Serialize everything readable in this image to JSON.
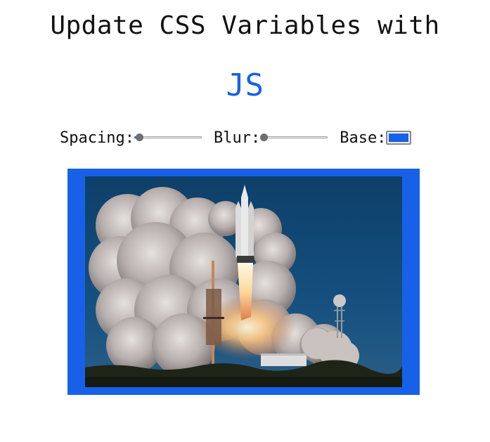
{
  "page": {
    "title_main": "Update CSS Variables with",
    "title_highlight": "JS"
  },
  "controls": {
    "spacing": {
      "label": "Spacing:",
      "value_fraction": 0.02
    },
    "blur": {
      "label": "Blur:",
      "value_fraction": 0.0
    },
    "base": {
      "label": "Base:",
      "color": "#1761e8"
    }
  },
  "image": {
    "subject": "rocket-launch-photo",
    "frame_color": "#1761e8"
  },
  "colors": {
    "accent": "#1761e8",
    "text": "#111111",
    "background": "#ffffff"
  }
}
